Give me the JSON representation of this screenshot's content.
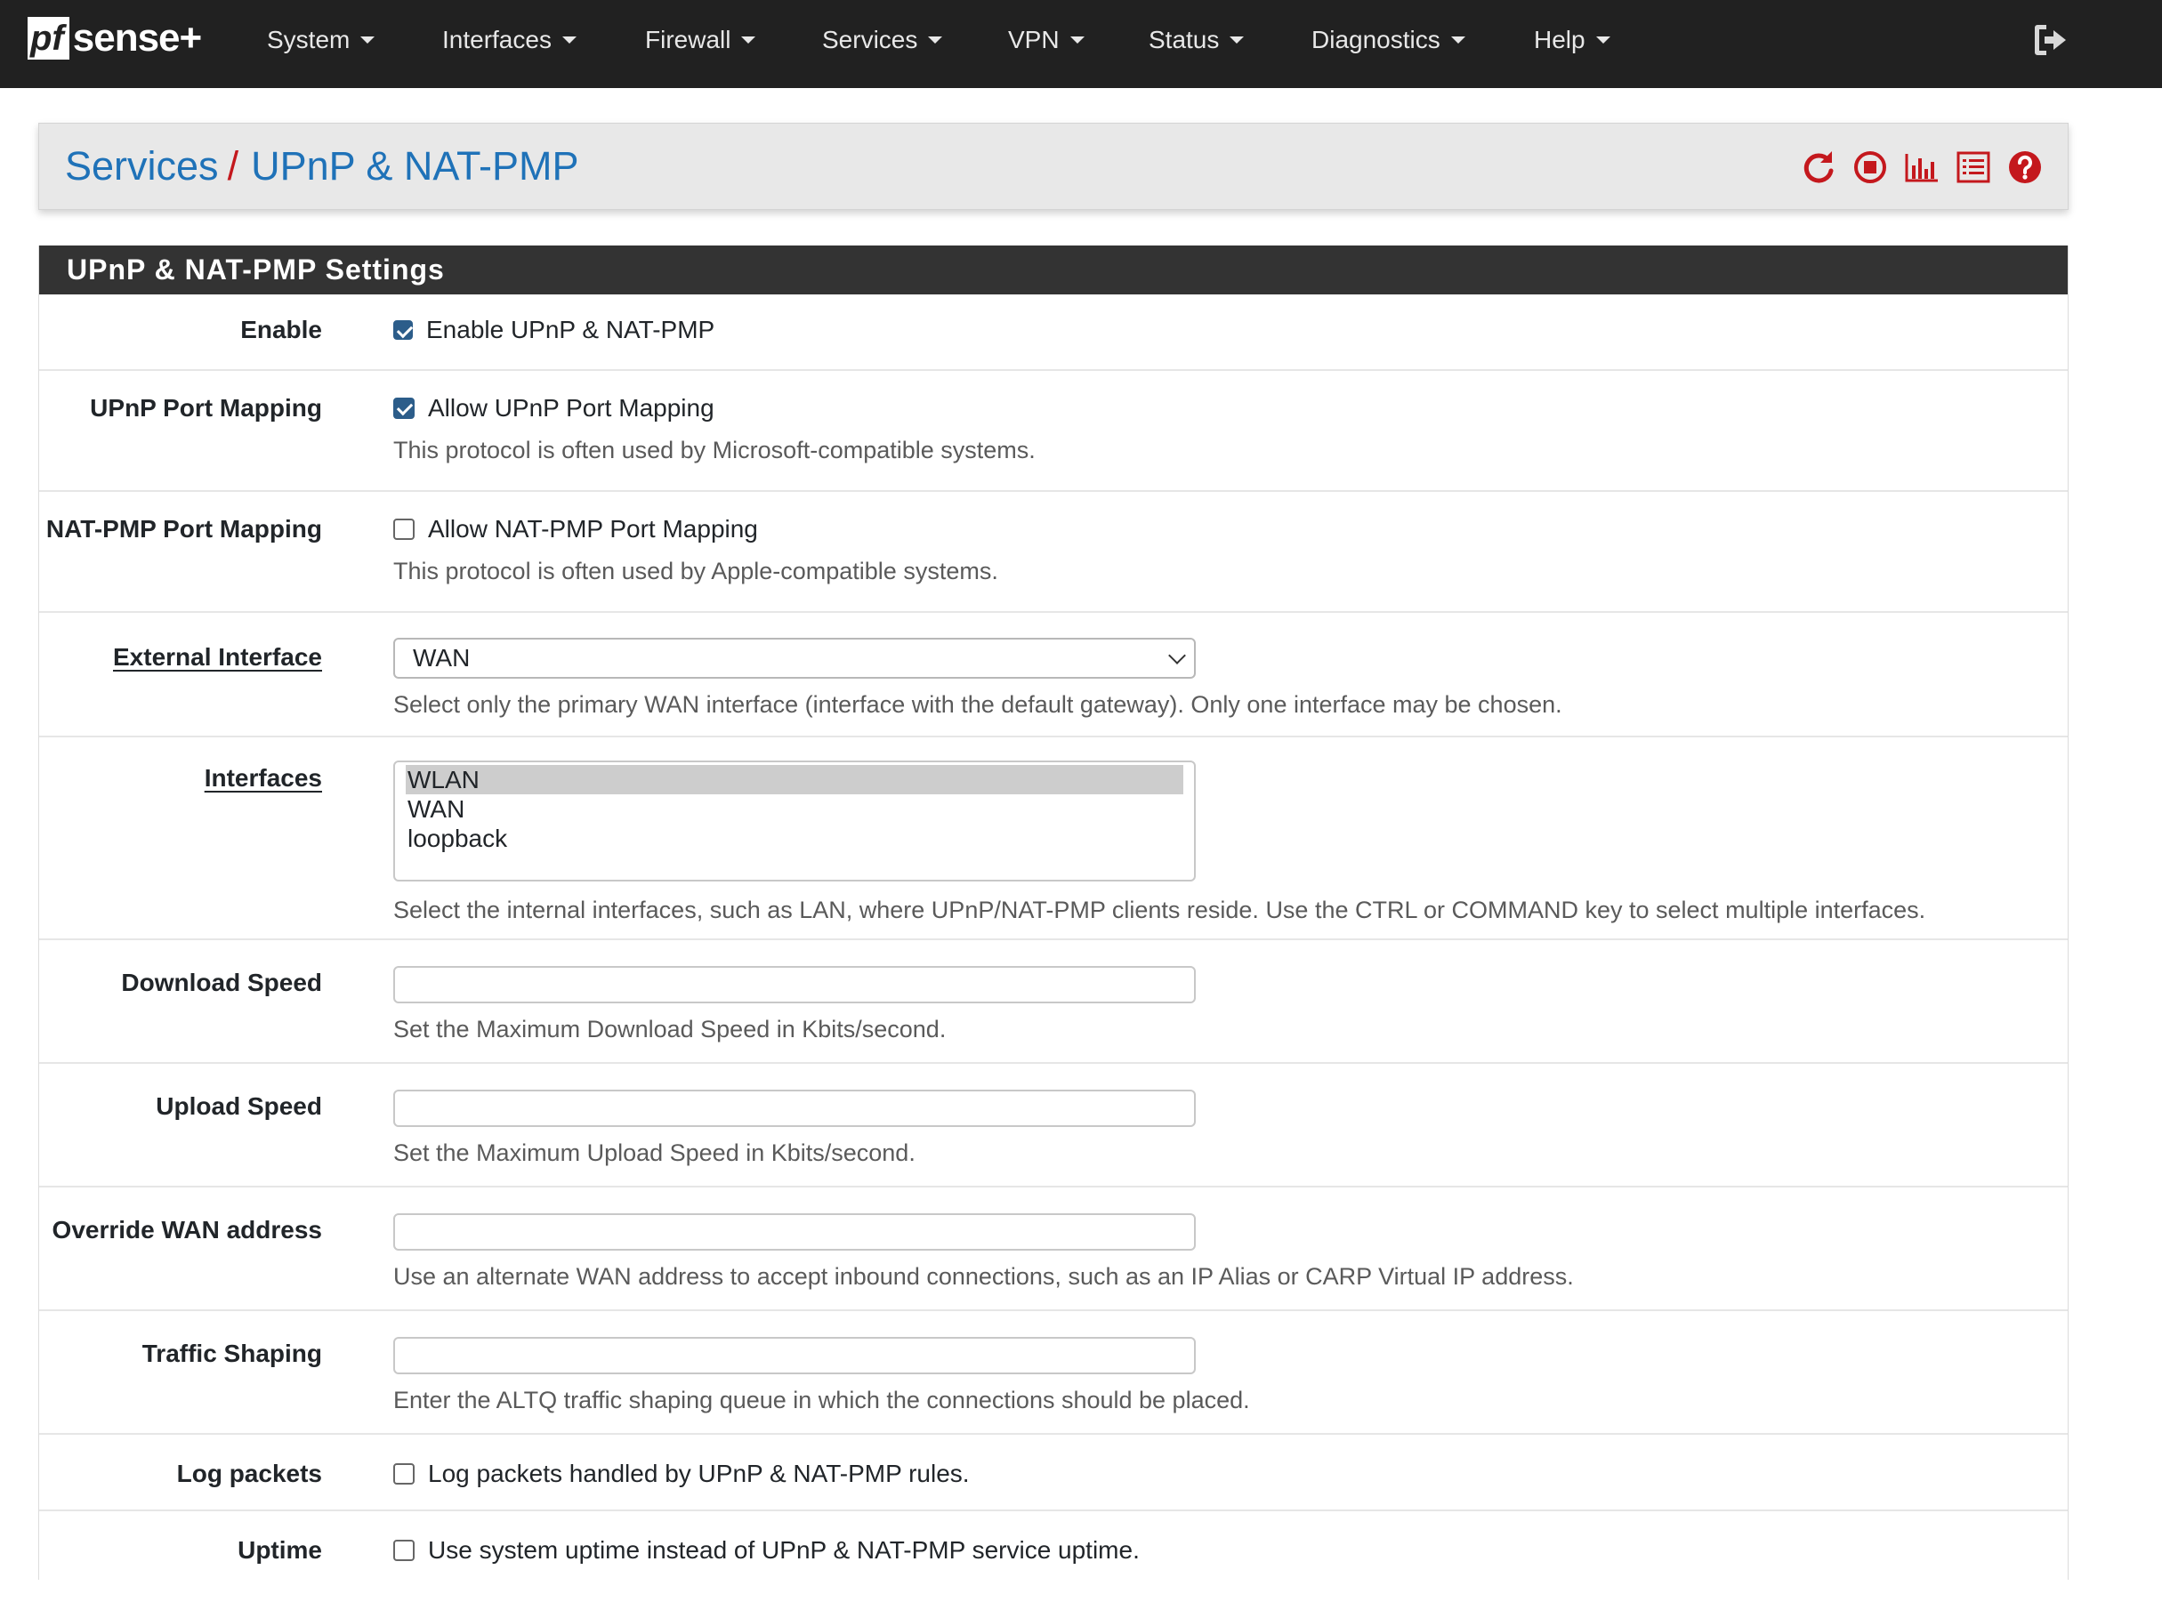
{
  "navbar": {
    "brand_pf": "pf",
    "brand_sense": "sense",
    "brand_plus": "+",
    "items": [
      {
        "label": "System"
      },
      {
        "label": "Interfaces"
      },
      {
        "label": "Firewall"
      },
      {
        "label": "Services"
      },
      {
        "label": "VPN"
      },
      {
        "label": "Status"
      },
      {
        "label": "Diagnostics"
      },
      {
        "label": "Help"
      }
    ],
    "logout_icon": "sign-out-icon"
  },
  "breadcrumb": {
    "parent": "Services",
    "separator": "/",
    "current": "UPnP & NAT-PMP",
    "icons": [
      "restart-service-icon",
      "stop-service-icon",
      "status-chart-icon",
      "log-list-icon",
      "help-icon"
    ],
    "icon_color": "#c4181d"
  },
  "panel": {
    "title": "UPnP & NAT-PMP Settings",
    "rows": {
      "enable": {
        "label": "Enable",
        "checkbox_label": "Enable UPnP & NAT-PMP",
        "checked": true
      },
      "upnp_port_mapping": {
        "label": "UPnP Port Mapping",
        "checkbox_label": "Allow UPnP Port Mapping",
        "checked": true,
        "help": "This protocol is often used by Microsoft-compatible systems."
      },
      "natpmp_port_mapping": {
        "label": "NAT-PMP Port Mapping",
        "checkbox_label": "Allow NAT-PMP Port Mapping",
        "checked": false,
        "help": "This protocol is often used by Apple-compatible systems."
      },
      "external_interface": {
        "label": "External Interface",
        "value": "WAN",
        "help": "Select only the primary WAN interface (interface with the default gateway). Only one interface may be chosen."
      },
      "interfaces": {
        "label": "Interfaces",
        "options": [
          "WLAN",
          "WAN",
          "loopback"
        ],
        "selected": "WLAN",
        "help": "Select the internal interfaces, such as LAN, where UPnP/NAT-PMP clients reside. Use the CTRL or COMMAND key to select multiple interfaces."
      },
      "download_speed": {
        "label": "Download Speed",
        "value": "",
        "help": "Set the Maximum Download Speed in Kbits/second."
      },
      "upload_speed": {
        "label": "Upload Speed",
        "value": "",
        "help": "Set the Maximum Upload Speed in Kbits/second."
      },
      "override_wan": {
        "label": "Override WAN address",
        "value": "",
        "help": "Use an alternate WAN address to accept inbound connections, such as an IP Alias or CARP Virtual IP address."
      },
      "traffic_shaping": {
        "label": "Traffic Shaping",
        "value": "",
        "help": "Enter the ALTQ traffic shaping queue in which the connections should be placed."
      },
      "log_packets": {
        "label": "Log packets",
        "checkbox_label": "Log packets handled by UPnP & NAT-PMP rules.",
        "checked": false
      },
      "uptime": {
        "label": "Uptime",
        "checkbox_label": "Use system uptime instead of UPnP & NAT-PMP service uptime.",
        "checked": false
      }
    }
  }
}
